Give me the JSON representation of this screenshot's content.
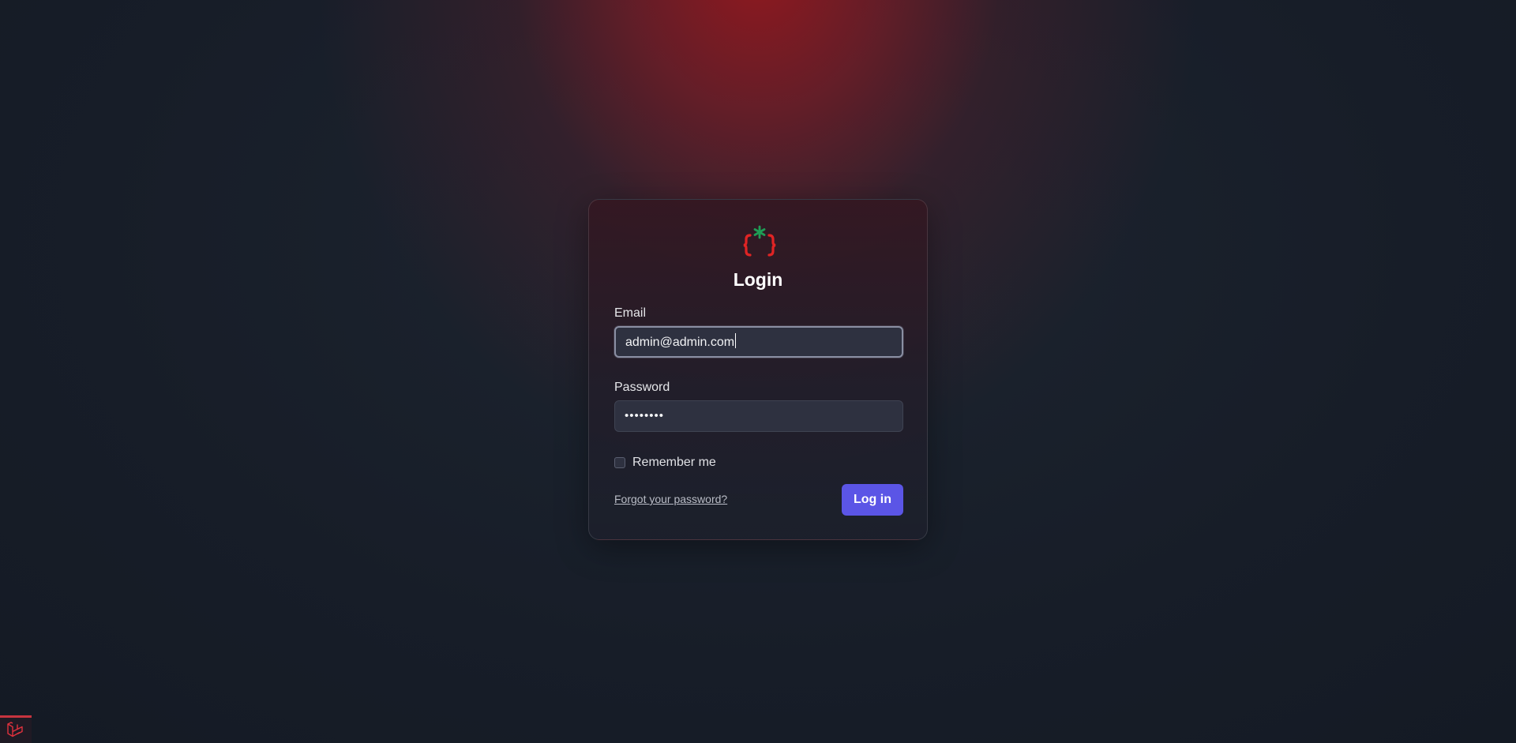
{
  "page": {
    "title": "Login"
  },
  "logo": {
    "icon": "braces-asterisk-logo-icon",
    "colors": {
      "braces": "#e02424",
      "asterisk": "#1f9d55"
    }
  },
  "form": {
    "email": {
      "label": "Email",
      "value": "admin@admin.com"
    },
    "password": {
      "label": "Password",
      "masked_value": "••••••••"
    },
    "remember": {
      "label": "Remember me",
      "checked": false
    },
    "forgot_link": "Forgot your password?",
    "submit_label": "Log in"
  },
  "corner": {
    "icon": "laravel-logo-icon"
  },
  "colors": {
    "accent": "#5b55e6",
    "background": "#161c27",
    "glow": "#8f1a20"
  }
}
